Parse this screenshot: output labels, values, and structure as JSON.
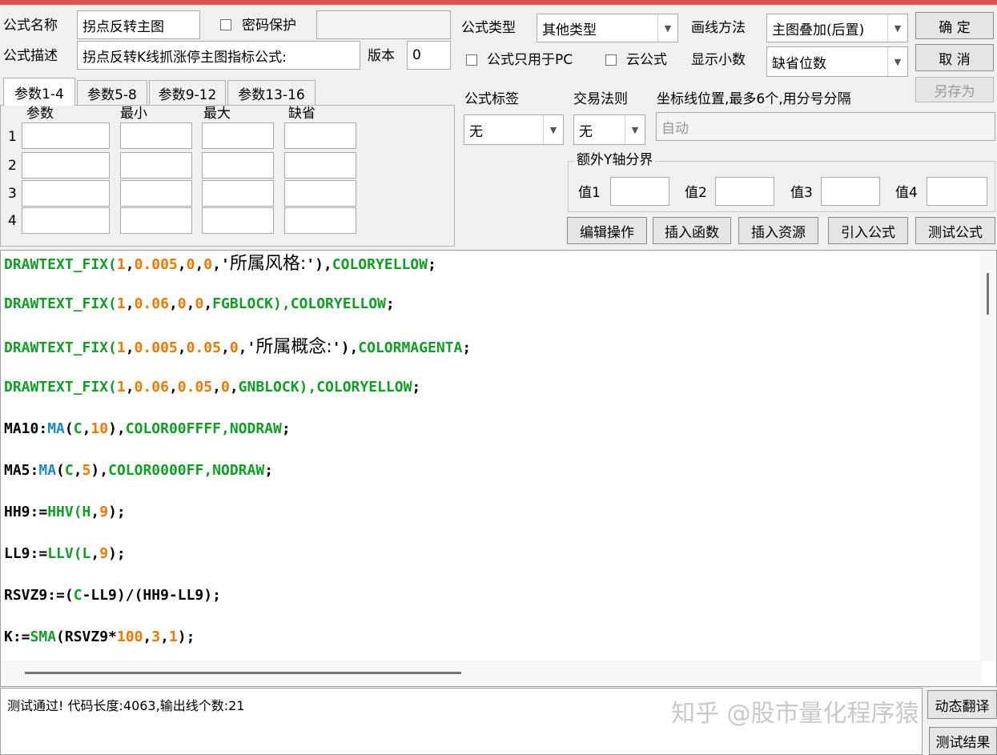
{
  "header": {
    "formula_name_label": "公式名称",
    "formula_name_value": "拐点反转主图",
    "password_label": "密码保护",
    "formula_desc_label": "公式描述",
    "formula_desc_value": "拐点反转K线抓涨停主图指标公式:",
    "version_label": "版本",
    "version_value": "0",
    "formula_type_label": "公式类型",
    "formula_type_value": "其他类型",
    "draw_method_label": "画线方法",
    "draw_method_value": "主图叠加(后置)",
    "pc_only_label": "公式只用于PC",
    "cloud_label": "云公式",
    "decimals_label": "显示小数",
    "decimals_value": "缺省位数"
  },
  "buttons": {
    "ok": "确 定",
    "cancel": "取 消",
    "save_as": "另存为",
    "edit_ops": "编辑操作",
    "insert_func": "插入函数",
    "insert_res": "插入资源",
    "import_formula": "引入公式",
    "test_formula": "测试公式",
    "dynamic_translate": "动态翻译",
    "test_result": "测试结果"
  },
  "params": {
    "tabs": [
      "参数1-4",
      "参数5-8",
      "参数9-12",
      "参数13-16"
    ],
    "columns": [
      "参数",
      "最小",
      "最大",
      "缺省"
    ],
    "rows": [
      "1",
      "2",
      "3",
      "4"
    ]
  },
  "right_panel": {
    "tag_label": "公式标签",
    "tag_value": "无",
    "trade_rule_label": "交易法则",
    "trade_rule_value": "无",
    "coord_label": "坐标线位置,最多6个,用分号分隔",
    "coord_value": "自动",
    "yaxis_group": "额外Y轴分界",
    "val1": "值1",
    "val2": "值2",
    "val3": "值3",
    "val4": "值4"
  },
  "code_lines": [
    [
      [
        "g",
        "DRAWTEXT_FIX("
      ],
      [
        "o",
        "1"
      ],
      [
        "k",
        ","
      ],
      [
        "o",
        "0.005"
      ],
      [
        "k",
        ","
      ],
      [
        "o",
        "0"
      ],
      [
        "k",
        ","
      ],
      [
        "o",
        "0"
      ],
      [
        "k",
        ",'"
      ],
      [
        "cjk",
        "所属风格:"
      ],
      [
        "k",
        "'),"
      ],
      [
        "g",
        "COLORYELLOW"
      ],
      [
        "k",
        ";"
      ]
    ],
    [
      [
        "g",
        "DRAWTEXT_FIX("
      ],
      [
        "o",
        "1"
      ],
      [
        "k",
        ","
      ],
      [
        "o",
        "0.06"
      ],
      [
        "k",
        ","
      ],
      [
        "o",
        "0"
      ],
      [
        "k",
        ","
      ],
      [
        "o",
        "0"
      ],
      [
        "k",
        ","
      ],
      [
        "g",
        "FGBLOCK),COLORYELLOW"
      ],
      [
        "k",
        ";"
      ]
    ],
    [
      [
        "g",
        "DRAWTEXT_FIX("
      ],
      [
        "o",
        "1"
      ],
      [
        "k",
        ","
      ],
      [
        "o",
        "0.005"
      ],
      [
        "k",
        ","
      ],
      [
        "o",
        "0.05"
      ],
      [
        "k",
        ","
      ],
      [
        "o",
        "0"
      ],
      [
        "k",
        ",'"
      ],
      [
        "cjk",
        "所属概念:"
      ],
      [
        "k",
        "'),"
      ],
      [
        "g",
        "COLORMAGENTA"
      ],
      [
        "k",
        ";"
      ]
    ],
    [
      [
        "g",
        "DRAWTEXT_FIX("
      ],
      [
        "o",
        "1"
      ],
      [
        "k",
        ","
      ],
      [
        "o",
        "0.06"
      ],
      [
        "k",
        ","
      ],
      [
        "o",
        "0.05"
      ],
      [
        "k",
        ","
      ],
      [
        "o",
        "0"
      ],
      [
        "k",
        ","
      ],
      [
        "g",
        "GNBLOCK),COLORYELLOW"
      ],
      [
        "k",
        ";"
      ]
    ],
    [
      [
        "k",
        "MA10:"
      ],
      [
        "b",
        "MA"
      ],
      [
        "k",
        "("
      ],
      [
        "g",
        "C"
      ],
      [
        "k",
        ","
      ],
      [
        "o",
        "10"
      ],
      [
        "k",
        "),"
      ],
      [
        "g",
        "COLOR00FFFF,NODRAW"
      ],
      [
        "k",
        ";"
      ]
    ],
    [
      [
        "k",
        "MA5:"
      ],
      [
        "b",
        "MA"
      ],
      [
        "k",
        "("
      ],
      [
        "g",
        "C"
      ],
      [
        "k",
        ","
      ],
      [
        "o",
        "5"
      ],
      [
        "k",
        "),"
      ],
      [
        "g",
        "COLOR0000FF,NODRAW"
      ],
      [
        "k",
        ";"
      ]
    ],
    [
      [
        "k",
        "HH9:="
      ],
      [
        "g",
        "HHV(H"
      ],
      [
        "k",
        ","
      ],
      [
        "o",
        "9"
      ],
      [
        "k",
        ");"
      ]
    ],
    [
      [
        "k",
        "LL9:="
      ],
      [
        "g",
        "LLV(L"
      ],
      [
        "k",
        ","
      ],
      [
        "o",
        "9"
      ],
      [
        "k",
        ");"
      ]
    ],
    [
      [
        "k",
        "RSVZ9:=("
      ],
      [
        "g",
        "C"
      ],
      [
        "k",
        "-LL9)/(HH9-LL9);"
      ]
    ],
    [
      [
        "k",
        "K:="
      ],
      [
        "g",
        "SMA"
      ],
      [
        "k",
        "(RSVZ9*"
      ],
      [
        "o",
        "100"
      ],
      [
        "k",
        ","
      ],
      [
        "o",
        "3"
      ],
      [
        "k",
        ","
      ],
      [
        "o",
        "1"
      ],
      [
        "k",
        ");"
      ]
    ]
  ],
  "status_text": "测试通过! 代码长度:4063,输出线个数:21",
  "watermark": "知乎 @股市量化程序猿"
}
